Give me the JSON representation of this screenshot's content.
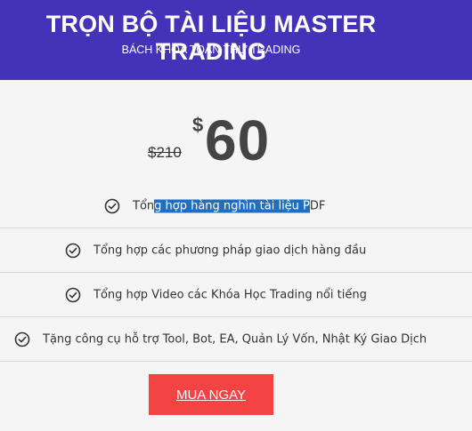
{
  "header": {
    "title": "TRỌN BỘ TÀI LIỆU MASTER TRADING",
    "subtitle": "BÁCH KHOA TOÀN THƯ TRADING"
  },
  "pricing": {
    "old_price": "$210",
    "currency": "$",
    "price": "60"
  },
  "features": [
    {
      "icon": "check-circle-icon",
      "text_before": "Tổn",
      "text_selected": "g hợp hàng nghìn tài liệu P",
      "text_after": "DF"
    },
    {
      "icon": "check-circle-icon",
      "text": "Tổng hợp các phương pháp giao dịch hàng đầu"
    },
    {
      "icon": "check-circle-icon",
      "text": "Tổng hợp Video các Khóa Học Trading nổi tiếng"
    },
    {
      "icon": "check-circle-icon",
      "text": "Tặng công cụ hỗ trợ Tool, Bot, EA, Quản Lý Vốn, Nhật Ký Giao Dịch"
    }
  ],
  "cta": {
    "label": "MUA NGAY"
  },
  "colors": {
    "header_bg": "#4433b8",
    "button_bg": "#f44343",
    "selection_bg": "#1f6fc0"
  }
}
